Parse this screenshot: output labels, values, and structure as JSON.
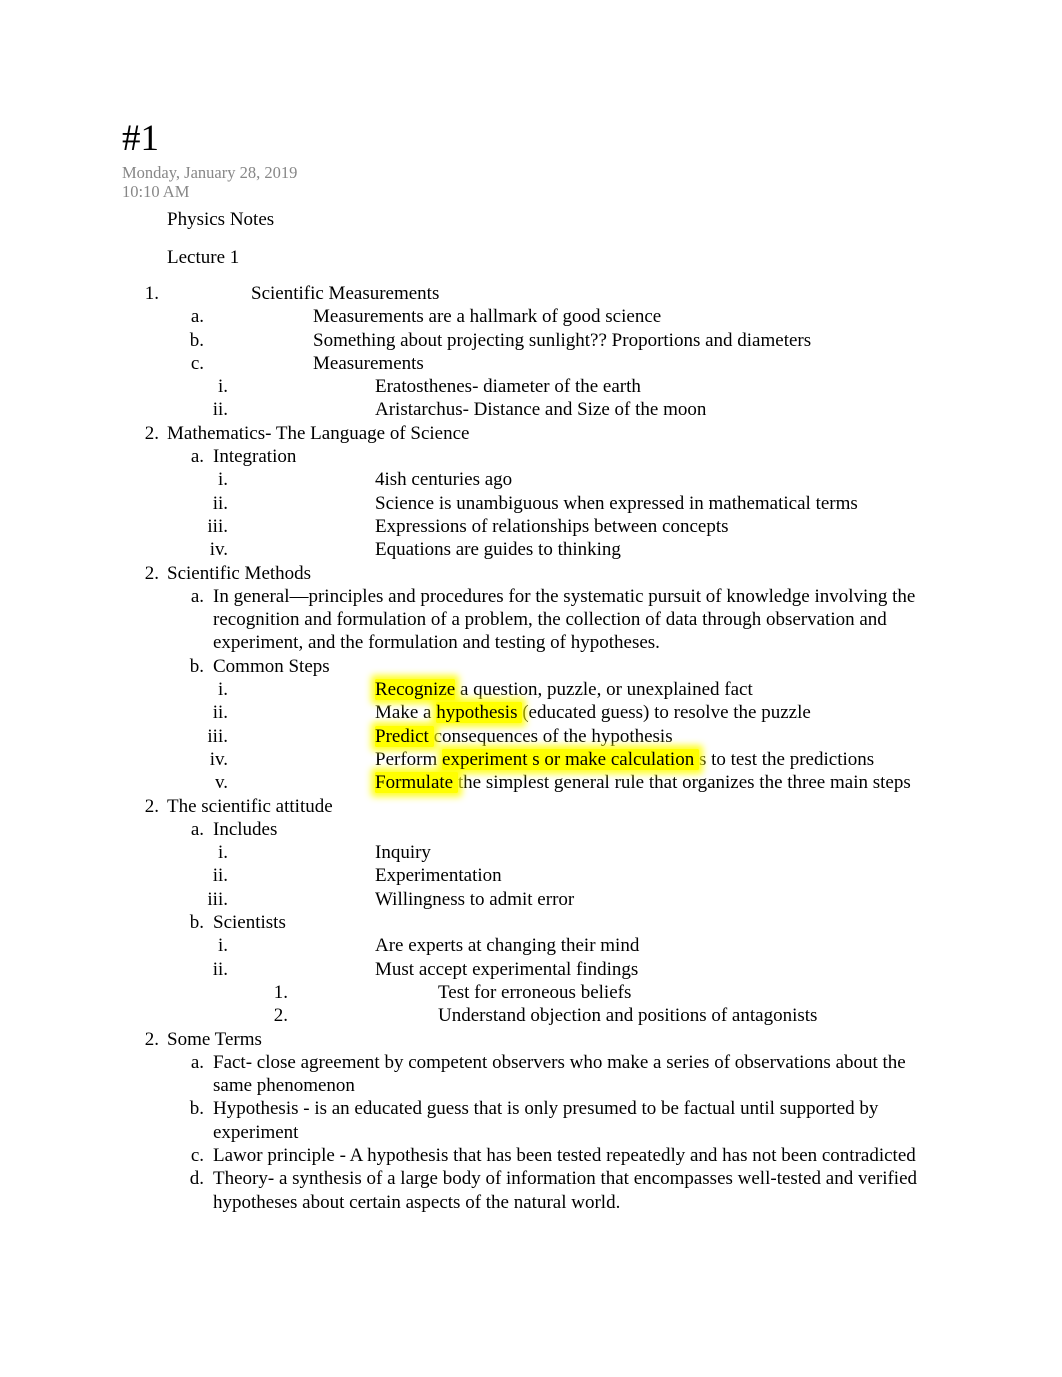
{
  "page": {
    "title": "#1",
    "date": "Monday, January 28, 2019",
    "time": "10:10 AM",
    "heading_1": "Physics Notes",
    "heading_2": "Lecture 1",
    "highlight_color": "#ffff00",
    "date_color": "#878787",
    "text_color": "#000000",
    "background_color": "#ffffff"
  },
  "outline": {
    "sections": [
      {
        "marker": "1.",
        "text": "Scientific Measurements",
        "children": [
          {
            "marker": "a.",
            "text": "Measurements are a hallmark of good science"
          },
          {
            "marker": "b.",
            "text": "Something about projecting sunlight?? Proportions and diameters"
          },
          {
            "marker": "c.",
            "text": "Measurements",
            "children": [
              {
                "marker": "i.",
                "text": "Eratosthenes- diameter of the earth"
              },
              {
                "marker": "ii.",
                "text": "Aristarchus- Distance and Size of the moon"
              }
            ]
          }
        ]
      },
      {
        "marker": "2.",
        "text": "Mathematics- The Language of Science",
        "children": [
          {
            "marker": "a.",
            "text": "Integration",
            "children": [
              {
                "marker": "i.",
                "text": "4ish centuries ago"
              },
              {
                "marker": "ii.",
                "text": "Science is unambiguous when expressed in mathematical terms"
              },
              {
                "marker": "iii.",
                "text": "Expressions of relationships between concepts"
              },
              {
                "marker": "iv.",
                "text": "Equations are guides to thinking"
              }
            ]
          }
        ]
      },
      {
        "marker": "2.",
        "text": "Scientific Methods",
        "children": [
          {
            "marker": "a.",
            "text": "In general—principles and procedures for the systematic pursuit of knowledge involving the recognition and formulation of a problem, the collection of data through observation and experiment, and the formulation and testing of hypotheses."
          },
          {
            "marker": "b.",
            "text": "Common Steps",
            "children": [
              {
                "marker": "i.",
                "parts": [
                  {
                    "text": "Recognize",
                    "highlight": true
                  },
                  {
                    "text": " a question, puzzle, or unexplained fact",
                    "highlight": false
                  }
                ]
              },
              {
                "marker": "ii.",
                "parts": [
                  {
                    "text": "Make a ",
                    "highlight": false
                  },
                  {
                    "text": "hypothesis ",
                    "highlight": true
                  },
                  {
                    "text": " (educated guess) to resolve the puzzle",
                    "highlight": false
                  }
                ]
              },
              {
                "marker": "iii.",
                "parts": [
                  {
                    "text": "Predict ",
                    "highlight": true
                  },
                  {
                    "text": " consequences of the hypothesis",
                    "highlight": false
                  }
                ]
              },
              {
                "marker": "iv.",
                "parts": [
                  {
                    "text": "Perform ",
                    "highlight": false
                  },
                  {
                    "text": "experiment s or make calculation ",
                    "highlight": true
                  },
                  {
                    "text": "s to test the predictions",
                    "highlight": false
                  }
                ]
              },
              {
                "marker": "v.",
                "parts": [
                  {
                    "text": "Formulate ",
                    "highlight": true
                  },
                  {
                    "text": " the simplest general rule that organizes the three main steps",
                    "highlight": false
                  }
                ]
              }
            ]
          }
        ]
      },
      {
        "marker": "2.",
        "text": "The scientific attitude",
        "children": [
          {
            "marker": "a.",
            "text": "Includes",
            "children": [
              {
                "marker": "i.",
                "text": "Inquiry"
              },
              {
                "marker": "ii.",
                "text": "Experimentation"
              },
              {
                "marker": "iii.",
                "text": "Willingness to admit error"
              }
            ]
          },
          {
            "marker": "b.",
            "text": "Scientists",
            "children": [
              {
                "marker": "i.",
                "text": "Are experts at changing their mind"
              },
              {
                "marker": "ii.",
                "text": "Must accept experimental findings",
                "children": [
                  {
                    "marker": "1.",
                    "text": "Test for erroneous beliefs"
                  },
                  {
                    "marker": "2.",
                    "text": "Understand objection and positions of antagonists"
                  }
                ]
              }
            ]
          }
        ]
      },
      {
        "marker": "2.",
        "text": "Some Terms",
        "children": [
          {
            "marker": "a.",
            "text": "Fact- close agreement by competent observers who make a series of observations about the same phenomenon"
          },
          {
            "marker": "b.",
            "text": "Hypothesis - is an educated guess that is only presumed to be factual until supported by experiment"
          },
          {
            "marker": "c.",
            "text": "Lawor principle - A hypothesis that has been tested repeatedly and has not been contradicted"
          },
          {
            "marker": "d.",
            "text": "Theory- a synthesis of a large body of information that encompasses well-tested and verified hypotheses about certain aspects of the natural world."
          }
        ]
      }
    ]
  }
}
